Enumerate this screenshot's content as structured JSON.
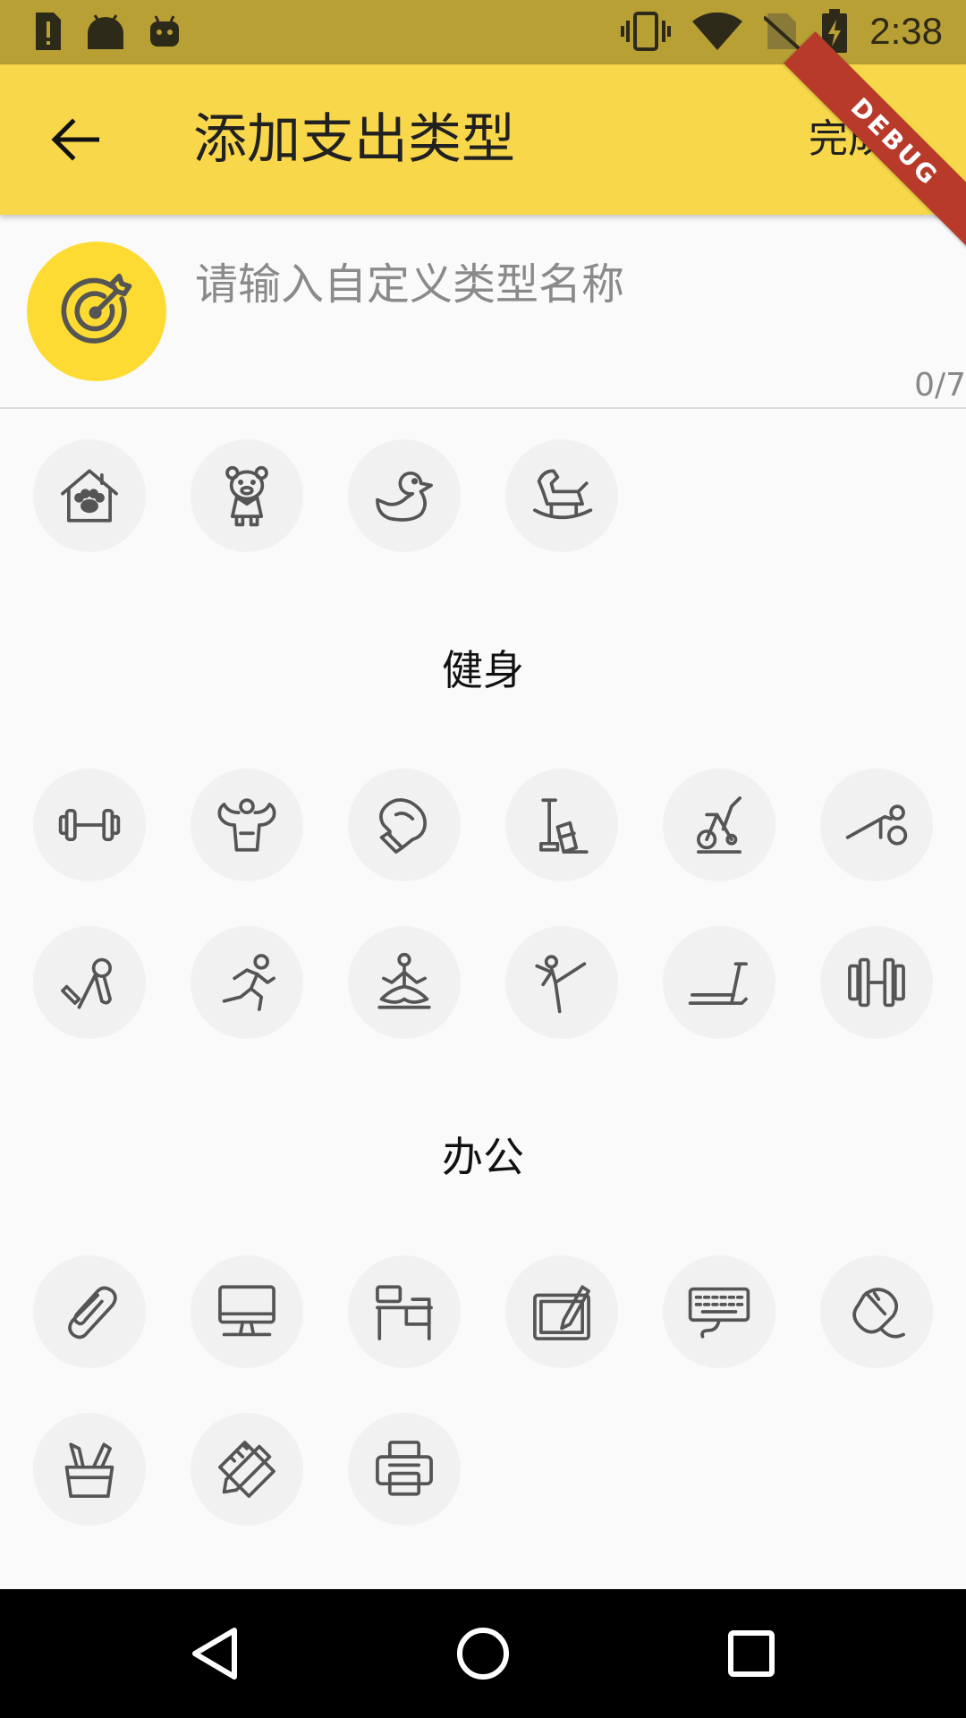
{
  "status_bar": {
    "time": "2:38",
    "icons": [
      "sim-alert-icon",
      "android-icon",
      "android-debug-icon",
      "vibrate-icon",
      "wifi-icon",
      "no-sim-icon",
      "battery-charging-icon"
    ]
  },
  "app_bar": {
    "back_icon": "arrow-back-icon",
    "title": "添加支出类型",
    "done_label": "完成",
    "debug_banner": "DEBUG",
    "background": "#f9d74a"
  },
  "input": {
    "selected_icon": "target-icon",
    "placeholder": "请输入自定义类型名称",
    "value": "",
    "counter": "0/7",
    "accent": "#fddb32"
  },
  "sections": [
    {
      "title": "",
      "icons": [
        "pet-house-icon",
        "teddy-bear-icon",
        "rubber-duck-icon",
        "rocking-horse-icon"
      ]
    },
    {
      "title": "健身",
      "icons": [
        "dumbbell-icon",
        "muscle-icon",
        "boxing-glove-icon",
        "hand-weights-icon",
        "exercise-bike-icon",
        "push-up-icon",
        "hand-grip-icon",
        "running-icon",
        "yoga-icon",
        "martial-arts-kick-icon",
        "treadmill-icon",
        "barbell-icon"
      ]
    },
    {
      "title": "办公",
      "icons": [
        "paperclip-icon",
        "desktop-computer-icon",
        "office-desk-icon",
        "drawing-tablet-icon",
        "keyboard-icon",
        "computer-mouse-icon",
        "pen-holder-icon",
        "pencil-ruler-icon",
        "printer-icon"
      ]
    }
  ],
  "nav_bar": {
    "icons": [
      "nav-back-icon",
      "nav-home-icon",
      "nav-recents-icon"
    ]
  }
}
